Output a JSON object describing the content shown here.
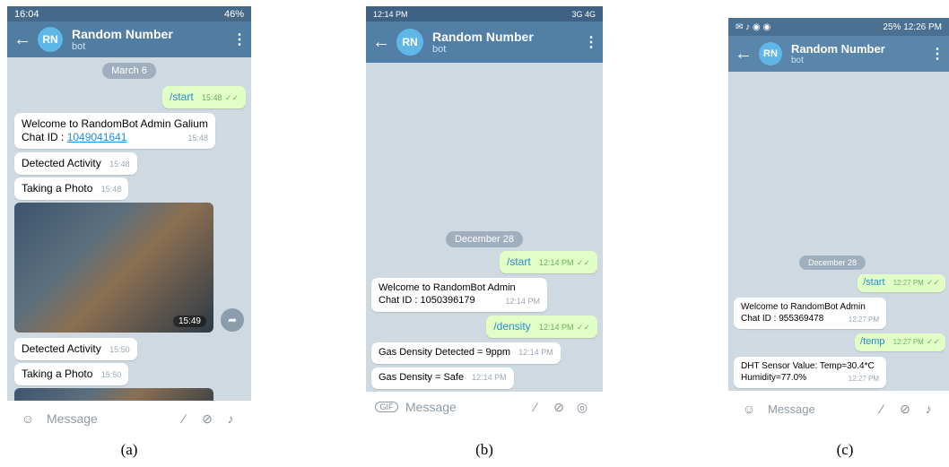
{
  "panels": [
    {
      "label": "(a)",
      "status": {
        "time": "16:04",
        "right": "46%"
      },
      "bot": {
        "avatar": "RN",
        "name": "Random Number",
        "subtitle": "bot"
      },
      "date_chip": "March 6",
      "start": {
        "text": "/start",
        "time": "15:48"
      },
      "welcome": {
        "line1": "Welcome to RandomBot Admin Galium",
        "chat_prefix": "Chat ID : ",
        "chat_id": "1049041641",
        "time": "15:48"
      },
      "activity1": {
        "text": "Detected Activity",
        "time": "15:48"
      },
      "photo_msg1": {
        "text": "Taking a Photo",
        "time": "15:48"
      },
      "photo_time": "15:49",
      "activity2": {
        "text": "Detected Activity",
        "time": "15:50"
      },
      "photo_msg2": {
        "text": "Taking a Photo",
        "time": "15:50"
      },
      "input_placeholder": "Message"
    },
    {
      "label": "(b)",
      "status": {
        "time": "12:14 PM",
        "right": "3G 4G"
      },
      "bot": {
        "avatar": "RN",
        "name": "Random Number",
        "subtitle": "bot"
      },
      "date_chip": "December 28",
      "start": {
        "text": "/start",
        "time": "12:14 PM"
      },
      "welcome": {
        "line1": "Welcome to RandomBot Admin",
        "line2": "Chat ID : 1050396179",
        "time": "12:14 PM"
      },
      "density_cmd": {
        "text": "/density",
        "time": "12:14 PM"
      },
      "gas1": {
        "text": "Gas Density Detected = 9ppm",
        "time": "12:14 PM"
      },
      "gas2": {
        "text": "Gas Density = Safe",
        "time": "12:14 PM"
      },
      "input_placeholder": "Message"
    },
    {
      "label": "(c)",
      "status": {
        "time": "12:26 PM",
        "right": "25%"
      },
      "bot": {
        "avatar": "RN",
        "name": "Random Number",
        "subtitle": "bot"
      },
      "date_chip": "December 28",
      "start": {
        "text": "/start",
        "time": "12:27 PM"
      },
      "welcome": {
        "line1": "Welcome to RandomBot Admin",
        "line2": "Chat ID : 955369478",
        "time": "12:27 PM"
      },
      "temp_cmd": {
        "text": "/temp",
        "time": "12:27 PM"
      },
      "dht": {
        "line1": "DHT Sensor Value: Temp=30.4*C",
        "line2": "Humidity=77.0%",
        "time": "12:27 PM"
      },
      "input_placeholder": "Message"
    }
  ],
  "colors": {
    "header_a": "#517da2",
    "header_b": "#527fa6",
    "header_c": "#5b86ac",
    "status_a": "#46698a",
    "status_b": "#3f6284",
    "status_c": "#4a7093",
    "chat_bg": "#cfd9e1",
    "outgoing_bubble": "#e1fec6"
  }
}
